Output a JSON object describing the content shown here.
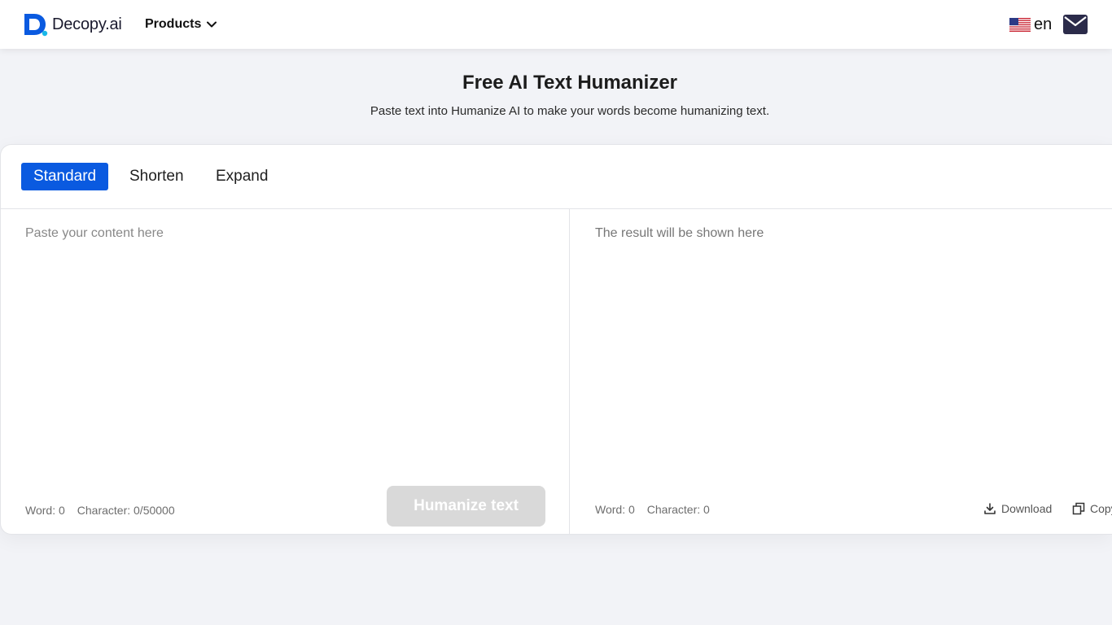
{
  "header": {
    "logo_text": "Decopy.ai",
    "products_label": "Products",
    "language": "en",
    "icons": {
      "logo": "decopy-logo-icon",
      "products": "chevron-down-icon",
      "flag": "us-flag-icon",
      "mail": "mail-icon"
    },
    "colors": {
      "brand": "#0a5ae0",
      "mail": "#2b2b4a"
    }
  },
  "hero": {
    "title": "Free AI Text Humanizer",
    "subtitle": "Paste text into Humanize AI to make your words become humanizing text."
  },
  "tabs": [
    {
      "label": "Standard",
      "active": true
    },
    {
      "label": "Shorten",
      "active": false
    },
    {
      "label": "Expand",
      "active": false
    }
  ],
  "input": {
    "placeholder": "Paste your content here",
    "value": "",
    "word_label": "Word: 0",
    "char_label": "Character: 0/50000",
    "submit_label": "Humanize text"
  },
  "output": {
    "placeholder": "The result will be shown here",
    "word_label": "Word: 0",
    "char_label": "Character: 0",
    "download_label": "Download",
    "copy_label": "Copy"
  }
}
